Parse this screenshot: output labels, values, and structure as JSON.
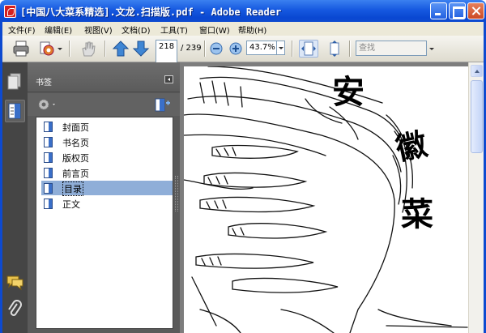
{
  "window": {
    "title": "[中国八大菜系精选].文龙.扫描版.pdf - Adobe Reader"
  },
  "menu": [
    "文件(F)",
    "编辑(E)",
    "视图(V)",
    "文档(D)",
    "工具(T)",
    "窗口(W)",
    "帮助(H)"
  ],
  "toolbar": {
    "current_page": "218",
    "page_count": "/ 239",
    "zoom": "43.7%",
    "search_placeholder": "查找"
  },
  "panel": {
    "title": "书签",
    "bookmarks": [
      {
        "label": "封面页",
        "selected": false
      },
      {
        "label": "书名页",
        "selected": false
      },
      {
        "label": "版权页",
        "selected": false
      },
      {
        "label": "前言页",
        "selected": false
      },
      {
        "label": "目录",
        "selected": true
      },
      {
        "label": "正文",
        "selected": false
      }
    ]
  },
  "document": {
    "title_chars": [
      "安",
      "徽",
      "菜"
    ]
  },
  "colors": {
    "titlebar": "#0d4ad0",
    "panel_bg": "#5a5a5a",
    "selection": "#8faed8"
  }
}
